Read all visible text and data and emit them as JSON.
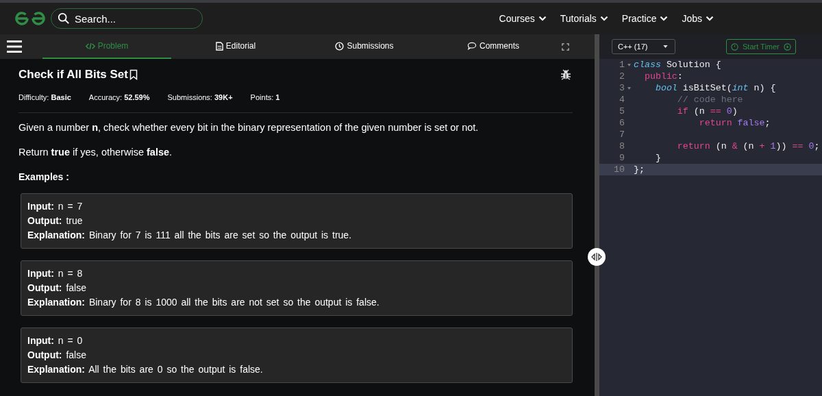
{
  "header": {
    "search": {
      "placeholder": "Search..."
    },
    "nav": [
      {
        "label": "Courses"
      },
      {
        "label": "Tutorials"
      },
      {
        "label": "Practice"
      },
      {
        "label": "Jobs"
      }
    ]
  },
  "tabs": [
    {
      "label": "Problem",
      "selected": true
    },
    {
      "label": "Editorial",
      "selected": false
    },
    {
      "label": "Submissions",
      "selected": false
    },
    {
      "label": "Comments",
      "selected": false
    }
  ],
  "problem": {
    "title": "Check if All Bits Set",
    "meta": [
      "Difficulty: **Basic**",
      "Accuracy: **52.59%**",
      "Submissions: **39K+**",
      "Points: **1**"
    ],
    "paragraphs": [
      "Given a number **n**, check whether every bit in the binary representation of the given number is set or not.",
      "Return **true** if yes, otherwise **false**."
    ],
    "examples_heading": "Examples :",
    "examples": [
      {
        "lines": [
          "**Input:** n = 7",
          "**Output:** true",
          "**Explanation:** Binary for 7 is 111 all the bits are set so the output is true."
        ]
      },
      {
        "lines": [
          "**Input:** n = 8",
          "**Output:** false",
          "**Explanation:** Binary for 8 is 1000 all the bits are not set so the output is false."
        ]
      },
      {
        "lines": [
          "**Input:** n = 0",
          "**Output:** false",
          "**Explanation:** All the bits are 0 so the output is false."
        ]
      }
    ]
  },
  "editor": {
    "language": "C++ (17)",
    "timer_button": "Start Timer",
    "lines": [
      {
        "number": "1",
        "foldable": true,
        "selected": false,
        "tokens": [
          {
            "kind": "type",
            "text": "class"
          },
          {
            "kind": "plain",
            "text": " Solution {"
          }
        ]
      },
      {
        "number": "2",
        "foldable": false,
        "selected": false,
        "tokens": [
          {
            "kind": "keyword",
            "text": "  public"
          },
          {
            "kind": "plain",
            "text": ":"
          }
        ]
      },
      {
        "number": "3",
        "foldable": true,
        "selected": false,
        "tokens": [
          {
            "kind": "type",
            "text": "    bool"
          },
          {
            "kind": "plain",
            "text": " isBitSet("
          },
          {
            "kind": "type",
            "text": "int"
          },
          {
            "kind": "plain",
            "text": " n) {"
          }
        ]
      },
      {
        "number": "4",
        "foldable": false,
        "selected": false,
        "tokens": [
          {
            "kind": "comment",
            "text": "        // code here"
          }
        ]
      },
      {
        "number": "5",
        "foldable": false,
        "selected": false,
        "tokens": [
          {
            "kind": "keyword",
            "text": "        if"
          },
          {
            "kind": "plain",
            "text": " (n "
          },
          {
            "kind": "operator",
            "text": "=="
          },
          {
            "kind": "number",
            "text": " 0"
          },
          {
            "kind": "plain",
            "text": ")"
          }
        ]
      },
      {
        "number": "6",
        "foldable": false,
        "selected": false,
        "tokens": [
          {
            "kind": "keyword",
            "text": "            return"
          },
          {
            "kind": "number",
            "text": " false"
          },
          {
            "kind": "plain",
            "text": ";"
          }
        ]
      },
      {
        "number": "7",
        "foldable": false,
        "selected": false
      },
      {
        "number": "8",
        "foldable": false,
        "selected": false,
        "tokens": [
          {
            "kind": "keyword",
            "text": "        return"
          },
          {
            "kind": "plain",
            "text": " (n "
          },
          {
            "kind": "operator",
            "text": "&"
          },
          {
            "kind": "plain",
            "text": " (n "
          },
          {
            "kind": "operator",
            "text": "+"
          },
          {
            "kind": "number",
            "text": " 1"
          },
          {
            "kind": "plain",
            "text": "))"
          },
          {
            "kind": "operator",
            "text": " =="
          },
          {
            "kind": "number",
            "text": " 0"
          },
          {
            "kind": "plain",
            "text": ";"
          }
        ]
      },
      {
        "number": "9",
        "foldable": false,
        "selected": false,
        "tokens": [
          {
            "kind": "plain",
            "text": "    }"
          }
        ]
      },
      {
        "number": "10",
        "foldable": false,
        "selected": true,
        "tokens": [
          {
            "kind": "plain",
            "text": "};"
          }
        ]
      }
    ]
  }
}
